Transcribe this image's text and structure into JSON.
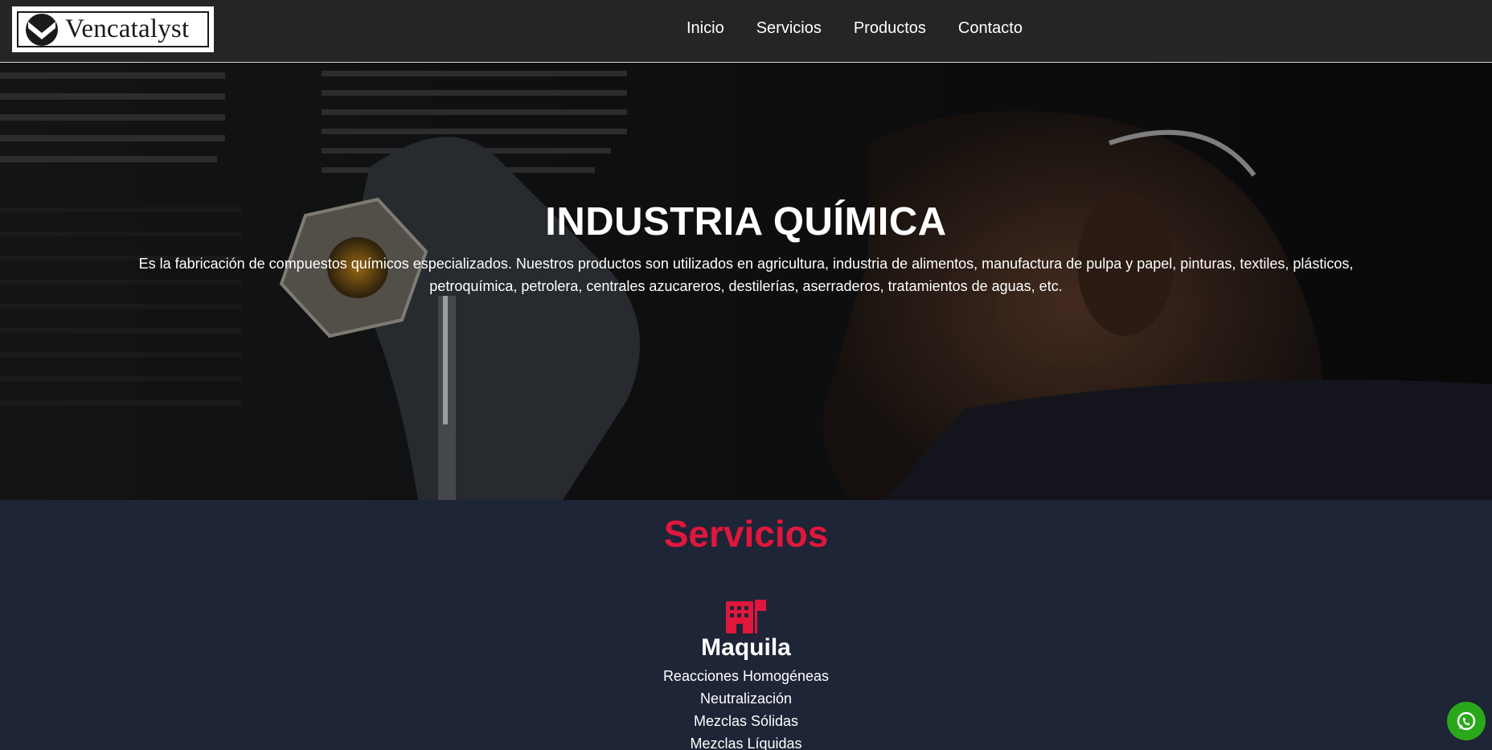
{
  "header": {
    "logo_text": "Vencatalyst",
    "nav": [
      "Inicio",
      "Servicios",
      "Productos",
      "Contacto"
    ]
  },
  "hero": {
    "title": "INDUSTRIA QUÍMICA",
    "description": "Es la fabricación de compuestos químicos especializados. Nuestros productos son utilizados en agricultura, industria de alimentos, manufactura de pulpa y papel, pinturas, textiles, plásticos, petroquímica, petrolera, centrales azucareros, destilerías, aserraderos, tratamientos de aguas, etc."
  },
  "services": {
    "title": "Servicios",
    "items": [
      {
        "icon": "industry-icon",
        "name": "Maquila",
        "list": [
          "Reacciones Homogéneas",
          "Neutralización",
          "Mezclas Sólidas",
          "Mezclas Líquidas"
        ]
      }
    ]
  },
  "floating": {
    "icon": "whatsapp-icon"
  },
  "colors": {
    "accent": "#e0173d",
    "header_bg": "#252525",
    "section_bg": "#1e2536",
    "whatsapp": "#2aa81a"
  }
}
